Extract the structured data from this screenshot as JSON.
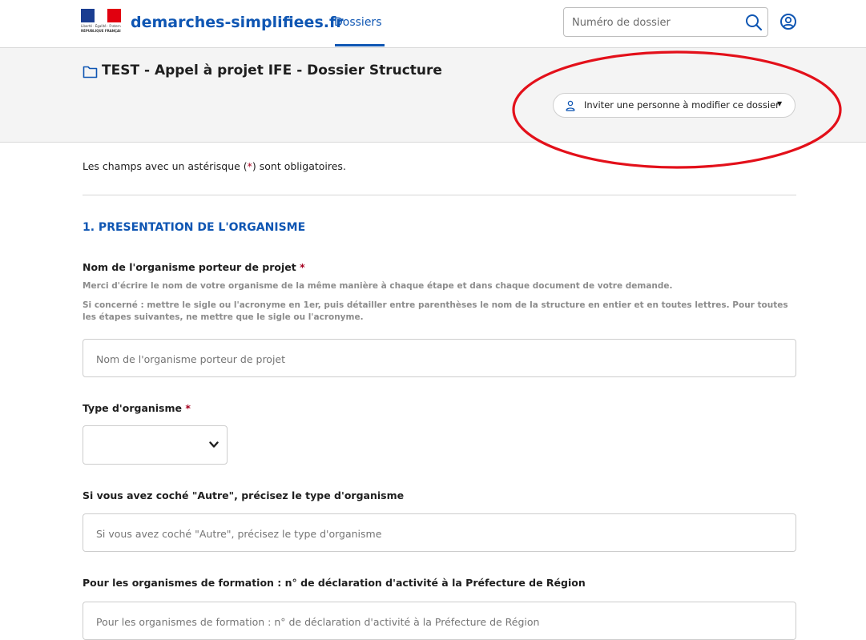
{
  "header": {
    "logo": {
      "motto": "Liberté · Égalité · Fraternité",
      "republic": "RÉPUBLIQUE FRANÇAISE",
      "colors": {
        "blue": "#1a3d91",
        "red": "#e1000f"
      }
    },
    "site_name": "demarches-simplifiees.fr",
    "nav_tab": "Dossiers",
    "search": {
      "placeholder": "Numéro de dossier",
      "icon": "search-icon"
    },
    "user_icon": "account-circle-icon"
  },
  "banner": {
    "folder_icon": "folder-icon",
    "title": "TEST - Appel à projet IFE - Dossier Structure",
    "invite_button": {
      "label": "Inviter une personne à modifier ce dossier",
      "caret": "▼",
      "icon": "user-icon"
    }
  },
  "form": {
    "required_notice_pre": "Les champs avec un astérisque (",
    "required_asterisk": "*",
    "required_notice_post": ") sont obligatoires.",
    "section_title": "1. PRESENTATION DE L'ORGANISME",
    "fields": [
      {
        "label": "Nom de l'organisme porteur de projet",
        "required": "*",
        "desc_1": "Merci d'écrire le nom de votre organisme de la même manière à chaque étape et dans chaque document de votre demande.",
        "desc_2": "Si concerné : mettre le sigle ou l'acronyme en 1er, puis détailler entre parenthèses le nom de la structure en entier et en toutes lettres. Pour toutes les étapes suivantes, ne mettre que le sigle ou l'acronyme.",
        "placeholder": "Nom de l'organisme porteur de projet"
      },
      {
        "label": "Type d'organisme",
        "required": "*",
        "selected_value": ""
      },
      {
        "label": "Si vous avez coché \"Autre\", précisez le type d'organisme",
        "placeholder": "Si vous avez coché \"Autre\", précisez le type d'organisme"
      },
      {
        "label": "Pour les organismes de formation : n° de déclaration d'activité à la Préfecture de Région",
        "placeholder": "Pour les organismes de formation : n° de déclaration d'activité à la Préfecture de Région"
      }
    ]
  },
  "colors": {
    "accent": "#0f56b3",
    "required": "#a5001f",
    "annotation_ellipse": "#e3101a"
  }
}
